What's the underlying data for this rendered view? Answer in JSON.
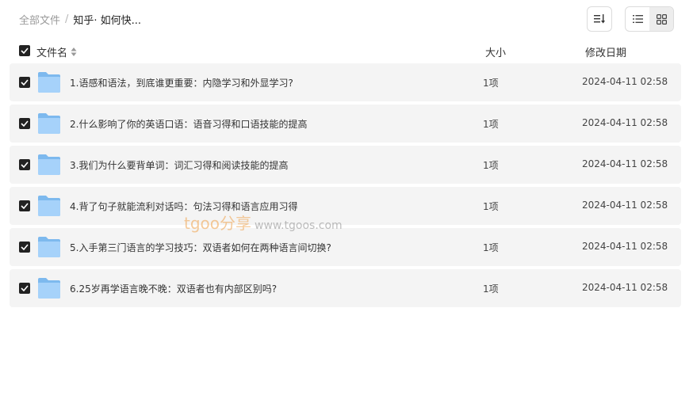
{
  "breadcrumb": {
    "root": "全部文件",
    "separator": "/",
    "current": "知乎· 如何快..."
  },
  "toolbar": {
    "sort_icon": "sort-icon",
    "list_view_icon": "list-view-icon",
    "grid_view_icon": "grid-view-icon",
    "active_view": "list"
  },
  "columns": {
    "name": "文件名",
    "size": "大小",
    "date": "修改日期"
  },
  "rows": [
    {
      "name": "1.语感和语法，到底谁更重要：内隐学习和外显学习?",
      "size": "1项",
      "date": "2024-04-11 02:58",
      "checked": true
    },
    {
      "name": "2.什么影响了你的英语口语：语音习得和口语技能的提高",
      "size": "1项",
      "date": "2024-04-11 02:58",
      "checked": true
    },
    {
      "name": "3.我们为什么要背单词：词汇习得和阅读技能的提高",
      "size": "1项",
      "date": "2024-04-11 02:58",
      "checked": true
    },
    {
      "name": "4.背了句子就能流利对话吗：句法习得和语言应用习得",
      "size": "1项",
      "date": "2024-04-11 02:58",
      "checked": true
    },
    {
      "name": "5.入手第三门语言的学习技巧：双语者如何在两种语言间切换?",
      "size": "1项",
      "date": "2024-04-11 02:58",
      "checked": true
    },
    {
      "name": "6.25岁再学语言晚不晚：双语者也有内部区别吗?",
      "size": "1项",
      "date": "2024-04-11 02:58",
      "checked": true
    }
  ],
  "watermark": {
    "brand": "tgoo",
    "share": "分享",
    "url": "www.tgoos.com"
  },
  "colors": {
    "row_bg": "#f4f4f4",
    "folder_blue": "#8ec5f5",
    "checkbox": "#222222",
    "watermark": "#f0a24a"
  }
}
